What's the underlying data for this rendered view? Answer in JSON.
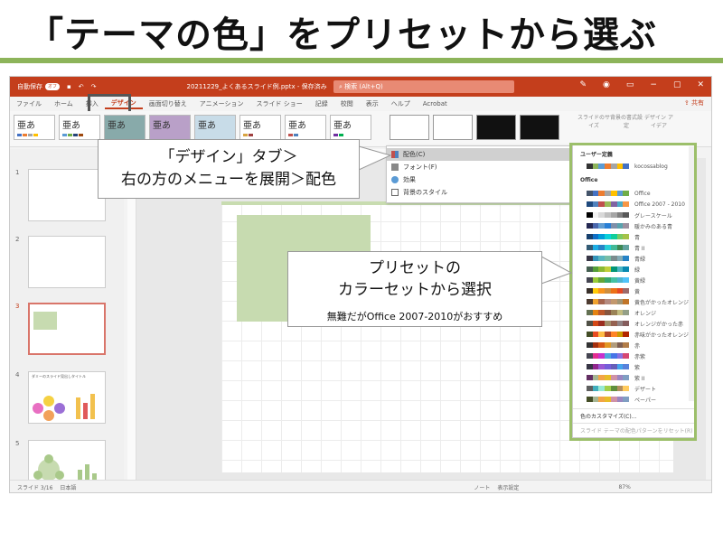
{
  "slide": {
    "title": "「テーマの色」をプリセットから選ぶ"
  },
  "colors": {
    "accent_green": "#8db45a",
    "office_red": "#c43e1c",
    "frame_green": "#9cbf6a"
  },
  "app": {
    "autosave_label": "自動保存",
    "autosave_state": "オフ",
    "file_name": "20211229_よくあるスライド例.pptx - 保存済み",
    "search_placeholder": "検索 (Alt+Q)",
    "share_label": "共有",
    "tabs": [
      "ファイル",
      "ホーム",
      "挿入",
      "デザイン",
      "画面切り替え",
      "アニメーション",
      "スライド ショー",
      "記録",
      "校閲",
      "表示",
      "ヘルプ",
      "Acrobat"
    ],
    "theme_label": "亜あ",
    "ribbon_buttons": [
      "スライドのサイズ",
      "背景の書式設定",
      "デザイン アイデア"
    ],
    "slide_numbers": [
      "1",
      "2",
      "3",
      "4",
      "5"
    ],
    "thumb4_title": "ダミーのスライド見出しタイトル",
    "status": {
      "slide": "スライド 3/16",
      "lang": "日本語",
      "notes": "ノート",
      "display": "表示設定",
      "zoom": "87%"
    }
  },
  "dropdown": {
    "items": [
      {
        "label": "配色(C)",
        "icon": "color-icon"
      },
      {
        "label": "フォント(F)",
        "icon": "font-icon"
      },
      {
        "label": "効果",
        "icon": "effects-icon"
      },
      {
        "label": "背景のスタイル",
        "icon": "background-icon"
      }
    ]
  },
  "palette": {
    "user_header": "ユーザー定義",
    "user_item": "kocossablog",
    "office_header": "Office",
    "items": [
      "Office",
      "Office 2007 - 2010",
      "グレースケール",
      "暖かみのある青",
      "青",
      "青 II",
      "青緑",
      "緑",
      "黄緑",
      "黄",
      "黄色がかったオレンジ",
      "オレンジ",
      "オレンジがかった赤",
      "赤味がかったオレンジ",
      "赤",
      "赤紫",
      "紫",
      "紫 II",
      "デザート",
      "ペーパー"
    ],
    "customize": "色のカスタマイズ(C)...",
    "reset": "スライド テーマの配色パターンをリセット(R)"
  },
  "callouts": {
    "first_line1": "「デザイン」タブ＞",
    "first_line2": "右の方のメニューを展開＞配色",
    "second_line1": "プリセットの",
    "second_line2": "カラーセットから選択",
    "second_note": "無難だがOffice 2007-2010がおすすめ"
  }
}
